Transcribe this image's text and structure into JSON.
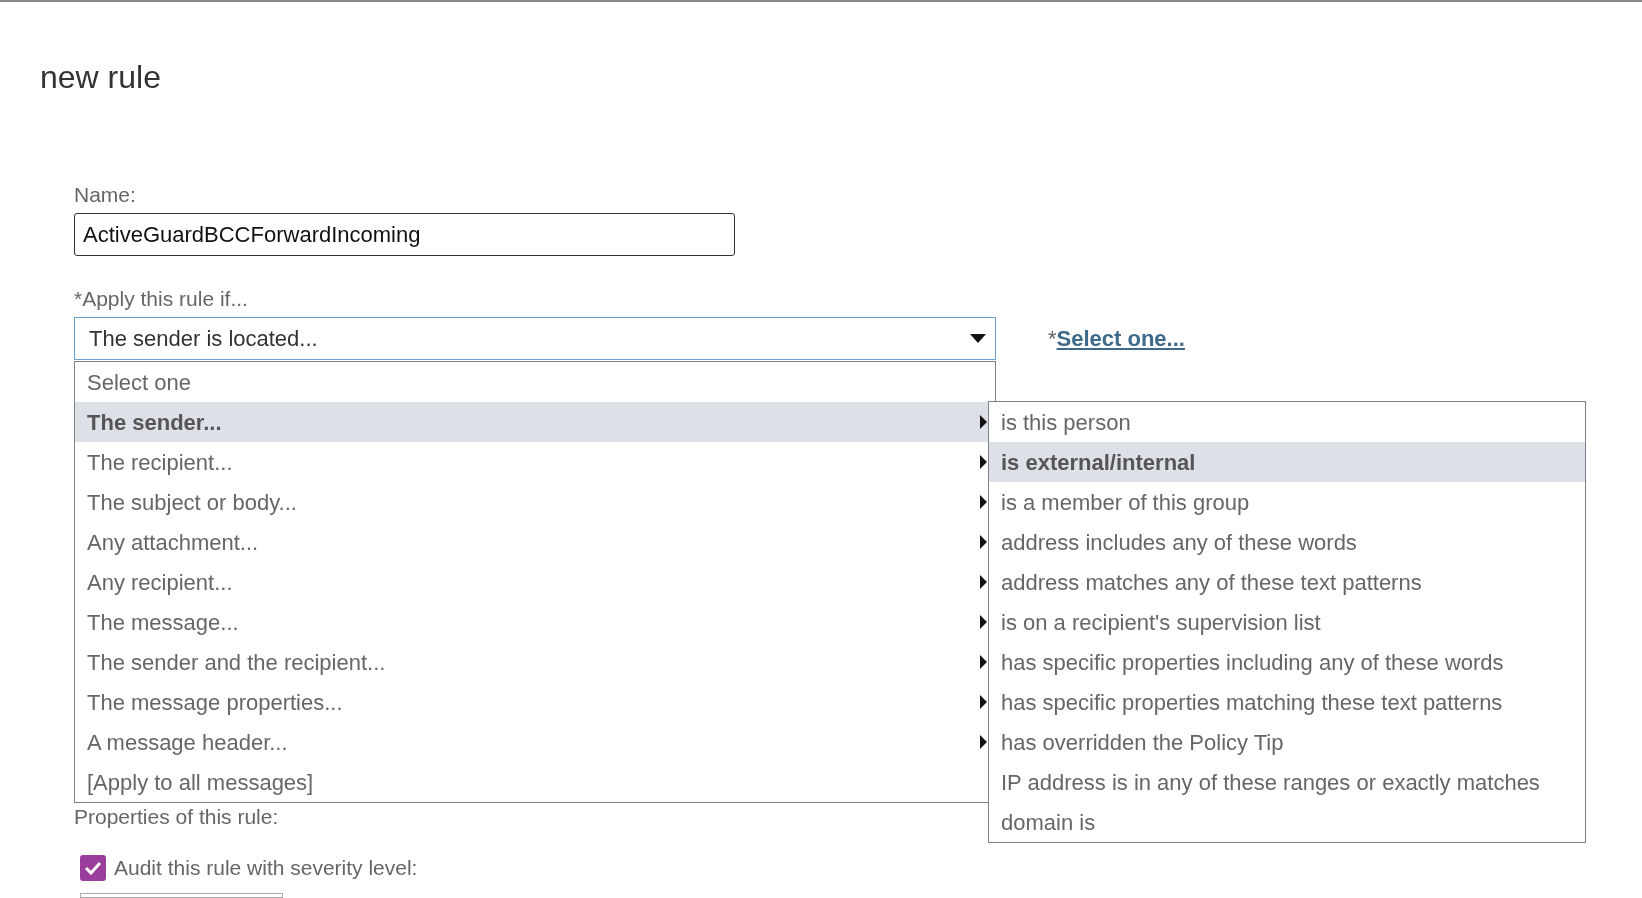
{
  "title": "new rule",
  "name_field": {
    "label": "Name:",
    "value": "ActiveGuardBCCForwardIncoming"
  },
  "condition": {
    "label": "*Apply this rule if...",
    "value": "The sender is located...",
    "expanded": true,
    "link_prefix": "*",
    "link": "Select one..."
  },
  "condition_menu": [
    {
      "label": "Select one",
      "has_submenu": false,
      "selected": false
    },
    {
      "label": "The sender...",
      "has_submenu": true,
      "selected": true
    },
    {
      "label": "The recipient...",
      "has_submenu": true,
      "selected": false
    },
    {
      "label": "The subject or body...",
      "has_submenu": true,
      "selected": false
    },
    {
      "label": "Any attachment...",
      "has_submenu": true,
      "selected": false
    },
    {
      "label": "Any recipient...",
      "has_submenu": true,
      "selected": false
    },
    {
      "label": "The message...",
      "has_submenu": true,
      "selected": false
    },
    {
      "label": "The sender and the recipient...",
      "has_submenu": true,
      "selected": false
    },
    {
      "label": "The message properties...",
      "has_submenu": true,
      "selected": false
    },
    {
      "label": "A message header...",
      "has_submenu": true,
      "selected": false
    },
    {
      "label": "[Apply to all messages]",
      "has_submenu": false,
      "selected": false
    }
  ],
  "submenu": [
    {
      "label": "is this person",
      "selected": false
    },
    {
      "label": "is external/internal",
      "selected": true
    },
    {
      "label": "is a member of this group",
      "selected": false
    },
    {
      "label": "address includes any of these words",
      "selected": false
    },
    {
      "label": "address matches any of these text patterns",
      "selected": false
    },
    {
      "label": "is on a recipient's supervision list",
      "selected": false
    },
    {
      "label": "has specific properties including any of these words",
      "selected": false
    },
    {
      "label": "has specific properties matching these text patterns",
      "selected": false
    },
    {
      "label": "has overridden the Policy Tip",
      "selected": false
    },
    {
      "label": "IP address is in any of these ranges or exactly matches",
      "selected": false
    },
    {
      "label": "domain is",
      "selected": false
    }
  ],
  "properties_label": "Properties of this rule:",
  "audit": {
    "label": "Audit this rule with severity level:",
    "checked": true
  }
}
